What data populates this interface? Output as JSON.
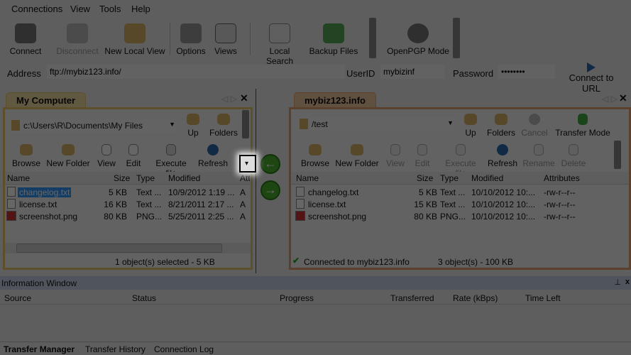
{
  "menu": [
    "Connections",
    "View",
    "Tools",
    "Help"
  ],
  "toolbar": [
    {
      "label": "Connect",
      "icon": "plug-icon",
      "enabled": true
    },
    {
      "label": "Disconnect",
      "icon": "unplug-icon",
      "enabled": false
    },
    {
      "label": "New Local View",
      "icon": "folder-window-icon",
      "enabled": true
    },
    {
      "label": "Options",
      "icon": "gauges-icon",
      "enabled": true
    },
    {
      "label": "Views",
      "icon": "magnifier-window-icon",
      "enabled": true
    },
    {
      "label": "Local Search",
      "icon": "binoculars-icon",
      "enabled": true
    },
    {
      "label": "Backup Files",
      "icon": "backup-disk-icon",
      "enabled": true
    },
    {
      "label": "OpenPGP Mode",
      "icon": "padlock-icon",
      "enabled": true
    }
  ],
  "address": {
    "label": "Address",
    "value": "ftp://mybiz123.info/",
    "userid_label": "UserID",
    "userid": "mybizinf",
    "password_label": "Password",
    "password": "••••••••",
    "connect_label": "Connect to URL"
  },
  "left": {
    "tab": "My Computer",
    "path": "c:\\Users\\R\\Documents\\My Files",
    "nav": [
      "Up",
      "Folders"
    ],
    "actions": [
      "Browse",
      "New Folder",
      "View",
      "Edit",
      "Execute file",
      "Refresh"
    ],
    "columns": [
      "Name",
      "Size",
      "Type",
      "Modified",
      "Attri"
    ],
    "rows": [
      {
        "name": "changelog.txt",
        "size": "5 KB",
        "type": "Text ...",
        "modified": "10/9/2012 1:19 ...",
        "attr": "A"
      },
      {
        "name": "license.txt",
        "size": "16 KB",
        "type": "Text ...",
        "modified": "8/21/2011 2:17 ...",
        "attr": "A"
      },
      {
        "name": "screenshot.png",
        "size": "80 KB",
        "type": "PNG...",
        "modified": "5/25/2011 2:25 ...",
        "attr": "A"
      }
    ],
    "status": "1 object(s) selected - 5 KB"
  },
  "right": {
    "tab": "mybiz123.info",
    "path": "/test",
    "nav": [
      "Up",
      "Folders",
      "Cancel",
      "Transfer Mode"
    ],
    "actions": [
      "Browse",
      "New Folder",
      "View",
      "Edit",
      "Execute file",
      "Refresh",
      "Rename",
      "Delete"
    ],
    "columns": [
      "Name",
      "Size",
      "Type",
      "Modified",
      "Attributes"
    ],
    "rows": [
      {
        "name": "changelog.txt",
        "size": "5 KB",
        "type": "Text ...",
        "modified": "10/10/2012 10:...",
        "attr": "-rw-r--r--"
      },
      {
        "name": "license.txt",
        "size": "15 KB",
        "type": "Text ...",
        "modified": "10/10/2012 10:...",
        "attr": "-rw-r--r--"
      },
      {
        "name": "screenshot.png",
        "size": "80 KB",
        "type": "PNG...",
        "modified": "10/10/2012 10:...",
        "attr": "-rw-r--r--"
      }
    ],
    "status_connection": "Connected to mybiz123.info",
    "status_count": "3 object(s) - 100 KB"
  },
  "info": {
    "title": "Information Window",
    "columns": [
      "Source",
      "Status",
      "Progress",
      "Transferred",
      "Rate (kBps)",
      "Time Left"
    ],
    "tabs": [
      "Transfer Manager",
      "Transfer History",
      "Connection Log"
    ]
  },
  "colors": {
    "local_accent": "#e8c66a",
    "remote_accent": "#e0a070",
    "selection": "#3399ff"
  }
}
